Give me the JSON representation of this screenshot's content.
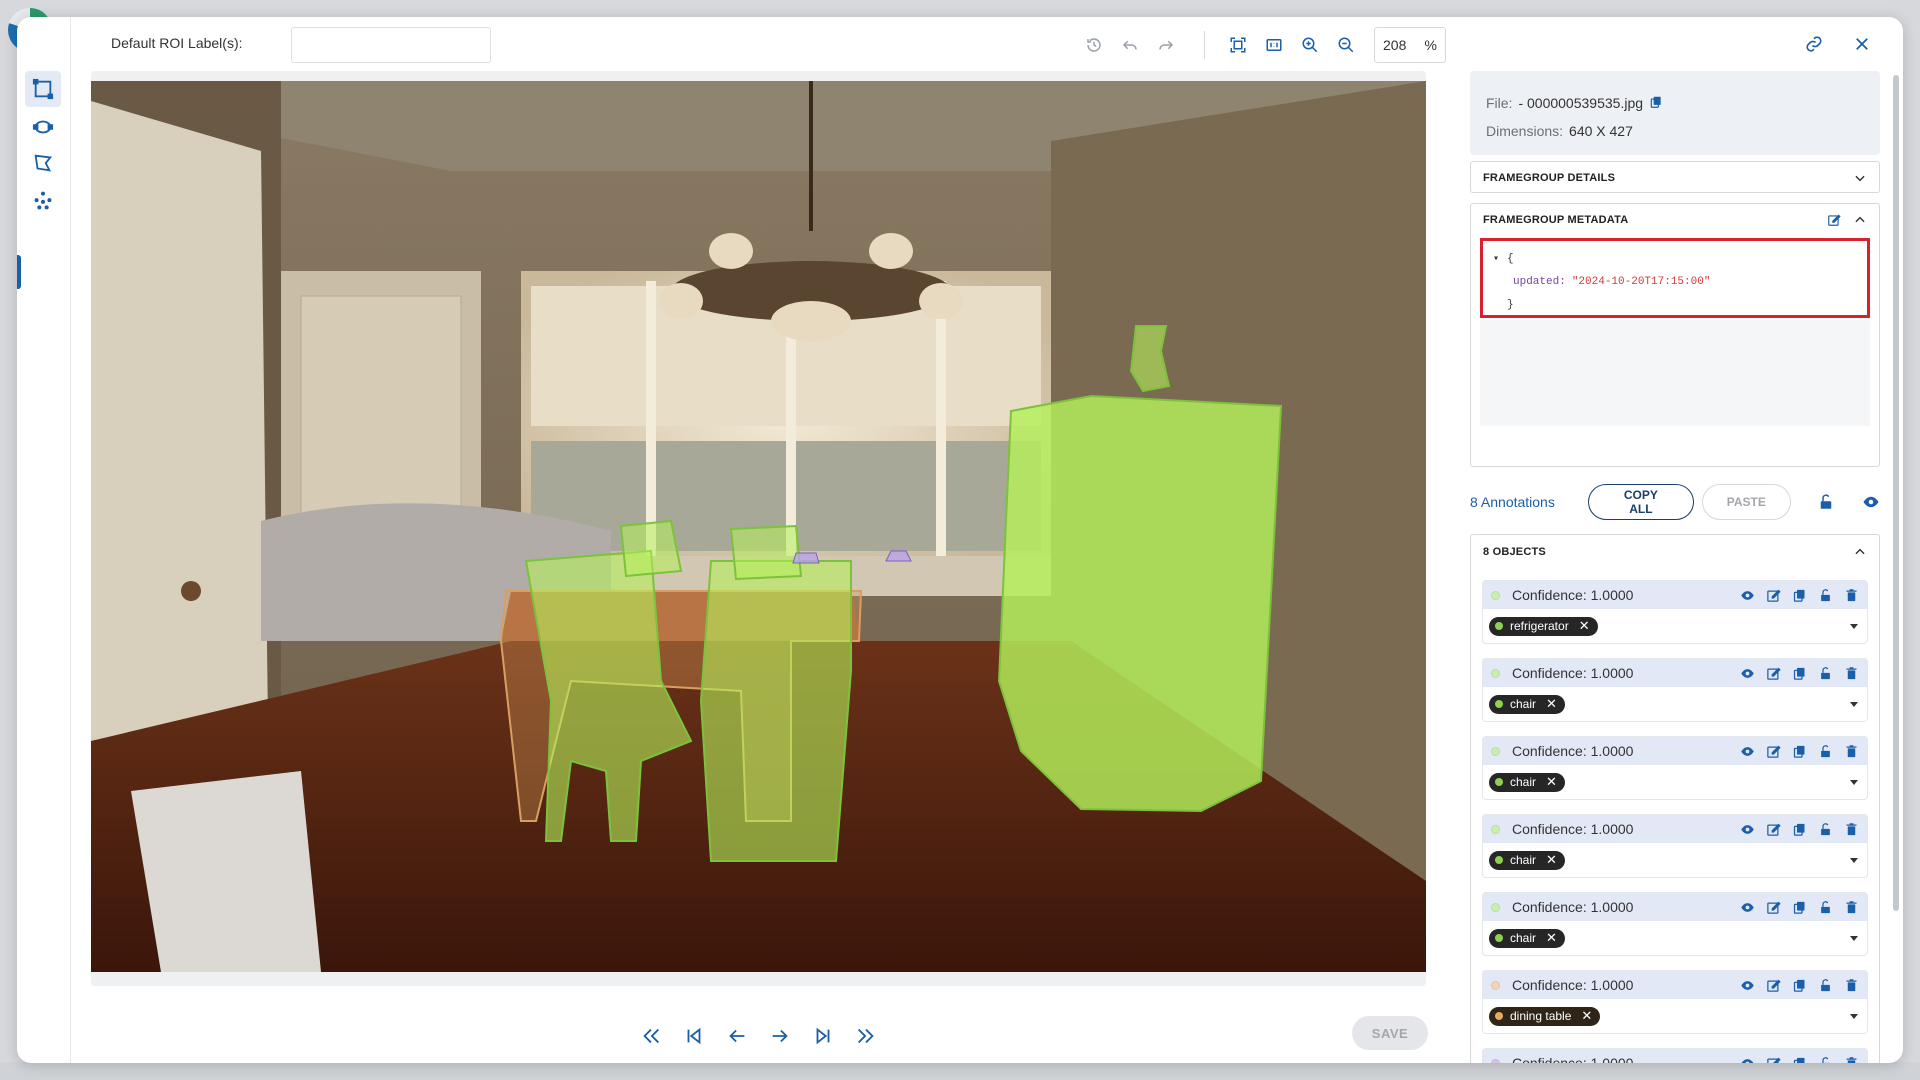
{
  "toolbar": {
    "roi_label": "Default ROI Label(s):",
    "roi_value": "",
    "zoom_value": "208",
    "zoom_unit": "%"
  },
  "file_info": {
    "file_label": "File:",
    "file_name": "- 000000539535.jpg",
    "dimensions_label": "Dimensions:",
    "dimensions_value": "640 X 427"
  },
  "framegroup_details": {
    "title": "FRAMEGROUP DETAILS"
  },
  "framegroup_metadata": {
    "title": "FRAMEGROUP METADATA",
    "json_open": "{",
    "json_key": "updated:",
    "json_value": "\"2024-10-20T17:15:00\"",
    "json_close": "}"
  },
  "annotations": {
    "count_label": "8 Annotations",
    "copy_all": "COPY ALL",
    "paste": "PASTE"
  },
  "objects": {
    "title": "8 OBJECTS",
    "items": [
      {
        "confidence": "Confidence: 1.0000",
        "label": "refrigerator",
        "dot_color": "#c9efb0"
      },
      {
        "confidence": "Confidence: 1.0000",
        "label": "chair",
        "dot_color": "#c9efb0"
      },
      {
        "confidence": "Confidence: 1.0000",
        "label": "chair",
        "dot_color": "#c9efb0"
      },
      {
        "confidence": "Confidence: 1.0000",
        "label": "chair",
        "dot_color": "#c9efb0"
      },
      {
        "confidence": "Confidence: 1.0000",
        "label": "chair",
        "dot_color": "#c9efb0"
      },
      {
        "confidence": "Confidence: 1.0000",
        "label": "dining table",
        "dot_color": "#f2d6b3"
      },
      {
        "confidence": "Confidence: 1.0000",
        "label": "",
        "dot_color": "#d6c3e8"
      }
    ]
  },
  "save_label": "SAVE",
  "colors": {
    "accent": "#1b5fa8",
    "highlight_box": "#d9212d",
    "annotation_fill": "#b5f05a",
    "header_bg": "#e3e8f7"
  }
}
